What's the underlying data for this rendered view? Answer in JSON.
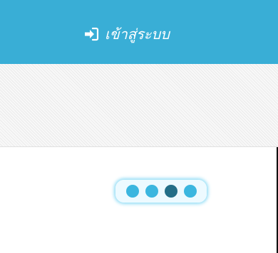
{
  "header": {
    "login_label": "เข้าสู่ระบบ",
    "login_icon": "sign-in-icon"
  },
  "colors": {
    "accent": "#39aed6",
    "accent_dark": "#236e87"
  },
  "loader": {
    "dots_total": 4,
    "active_dot": 3
  }
}
